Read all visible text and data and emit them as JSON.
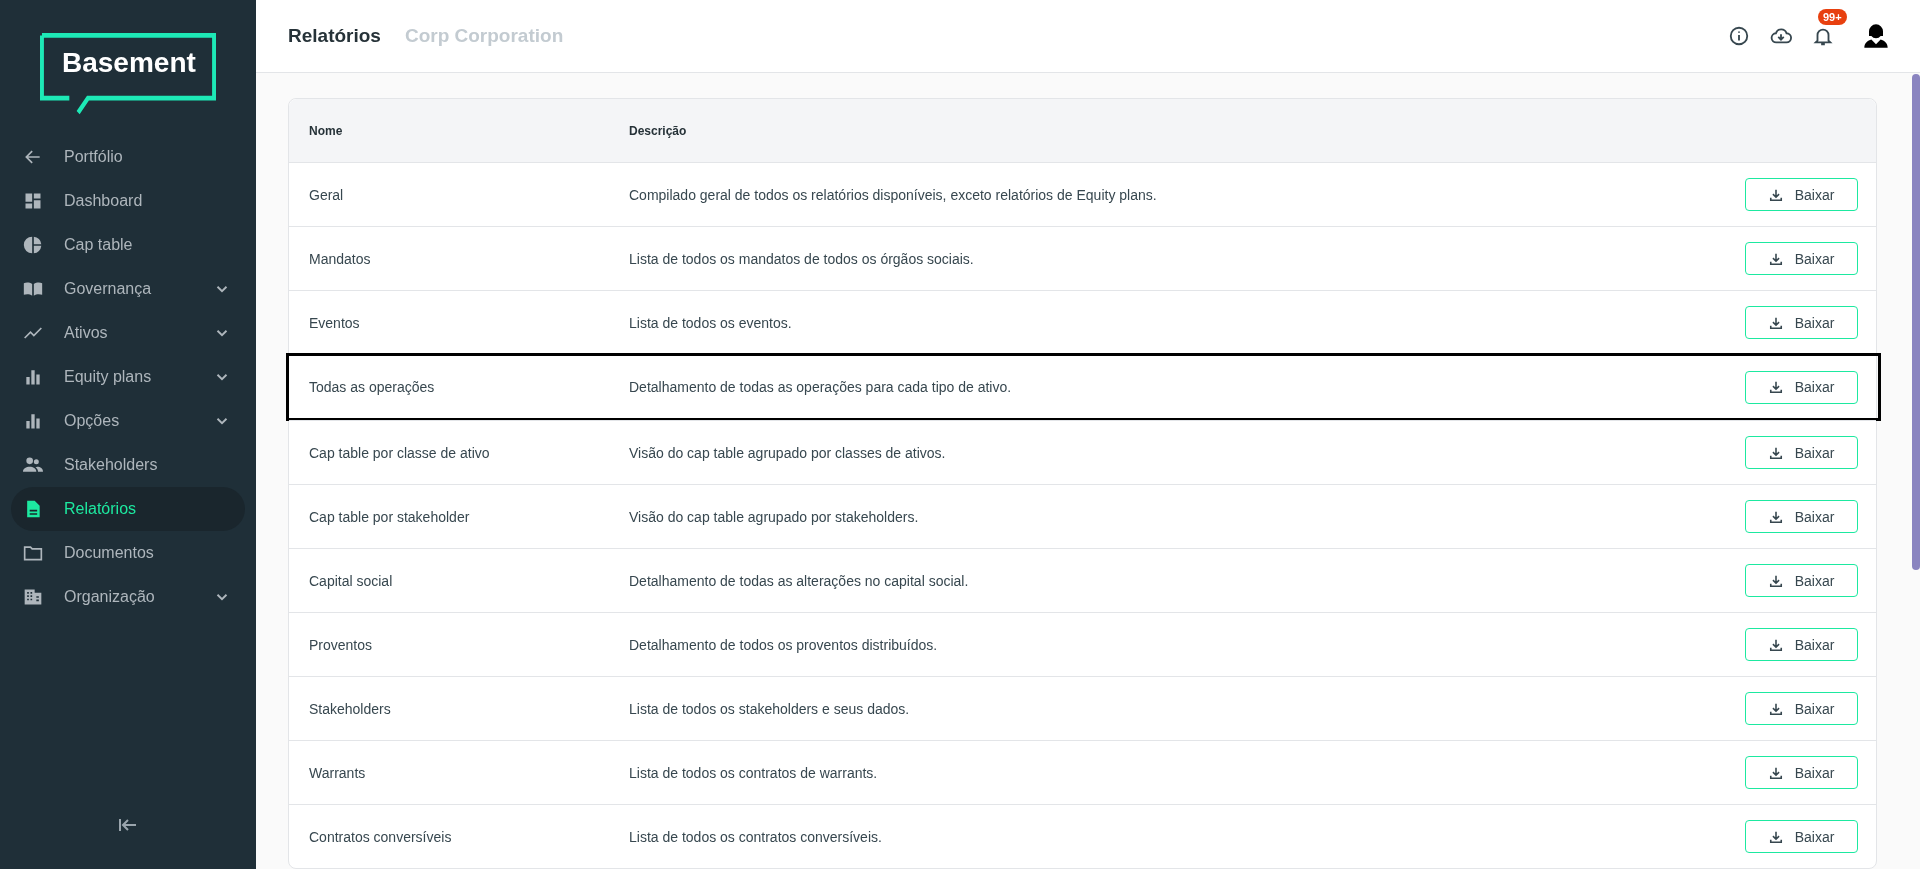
{
  "sidebar": {
    "logo": "Basement",
    "items": [
      {
        "label": "Portfólio",
        "kind": "link",
        "selected": false
      },
      {
        "label": "Dashboard",
        "kind": "link",
        "selected": false
      },
      {
        "label": "Cap table",
        "kind": "link",
        "selected": false
      },
      {
        "label": "Governança",
        "kind": "group",
        "selected": false
      },
      {
        "label": "Ativos",
        "kind": "group",
        "selected": false
      },
      {
        "label": "Equity plans",
        "kind": "group",
        "selected": false
      },
      {
        "label": "Opções",
        "kind": "group",
        "selected": false
      },
      {
        "label": "Stakeholders",
        "kind": "link",
        "selected": false
      },
      {
        "label": "Relatórios",
        "kind": "link",
        "selected": true
      },
      {
        "label": "Documentos",
        "kind": "link",
        "selected": false
      },
      {
        "label": "Organização",
        "kind": "group",
        "selected": false
      }
    ]
  },
  "header": {
    "title": "Relatórios",
    "subtitle": "Corp Corporation",
    "notification_badge": "99+"
  },
  "table": {
    "columns": [
      "Nome",
      "Descrição"
    ],
    "rows": [
      {
        "name": "Geral",
        "description": "Compilado geral de todos os relatórios disponíveis, exceto relatórios de Equity plans.",
        "action": "Baixar",
        "highlighted": false
      },
      {
        "name": "Mandatos",
        "description": "Lista de todos os mandatos de todos os órgãos sociais.",
        "action": "Baixar",
        "highlighted": false
      },
      {
        "name": "Eventos",
        "description": "Lista de todos os eventos.",
        "action": "Baixar",
        "highlighted": false
      },
      {
        "name": "Todas as operações",
        "description": "Detalhamento de todas as operações para cada tipo de ativo.",
        "action": "Baixar",
        "highlighted": true
      },
      {
        "name": "Cap table por classe de ativo",
        "description": "Visão do cap table agrupado por classes de ativos.",
        "action": "Baixar",
        "highlighted": false
      },
      {
        "name": "Cap table por stakeholder",
        "description": "Visão do cap table agrupado por stakeholders.",
        "action": "Baixar",
        "highlighted": false
      },
      {
        "name": "Capital social",
        "description": "Detalhamento de todas as alterações no capital social.",
        "action": "Baixar",
        "highlighted": false
      },
      {
        "name": "Proventos",
        "description": "Detalhamento de todos os proventos distribuídos.",
        "action": "Baixar",
        "highlighted": false
      },
      {
        "name": "Stakeholders",
        "description": "Lista de todos os stakeholders e seus dados.",
        "action": "Baixar",
        "highlighted": false
      },
      {
        "name": "Warrants",
        "description": "Lista de todos os contratos de warrants.",
        "action": "Baixar",
        "highlighted": false
      },
      {
        "name": "Contratos conversíveis",
        "description": "Lista de todos os contratos conversíveis.",
        "action": "Baixar",
        "highlighted": false
      }
    ]
  }
}
